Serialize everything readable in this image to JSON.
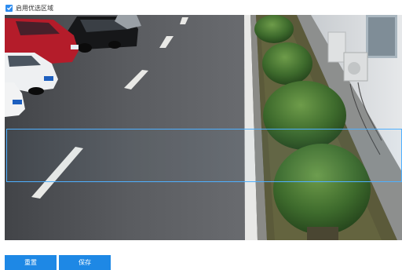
{
  "checkbox": {
    "label": "启用优选区域",
    "checked": true
  },
  "buttons": {
    "reset_label": "重置",
    "save_label": "保存"
  },
  "colors": {
    "accent": "#2d8cf0",
    "button": "#1e88e5",
    "region_border": "#4fb0ff"
  }
}
